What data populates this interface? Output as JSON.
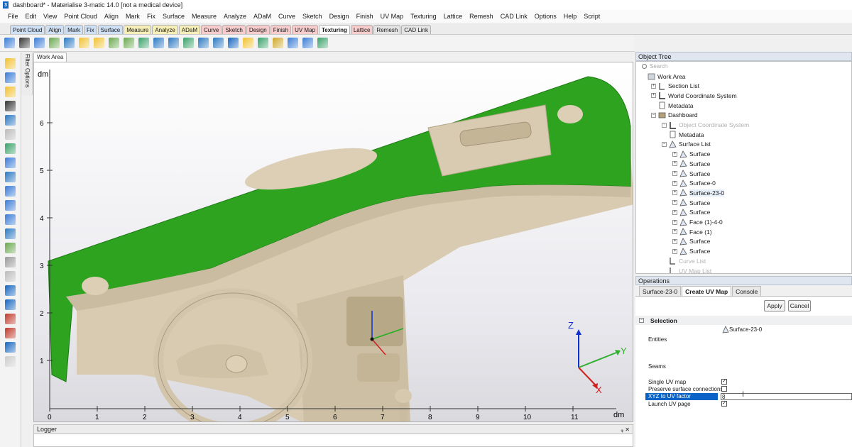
{
  "window": {
    "title": "dashboard* - Materialise 3-matic 14.0 [not a medical device]",
    "logo": "3"
  },
  "menu": [
    "File",
    "Edit",
    "View",
    "Point Cloud",
    "Align",
    "Mark",
    "Fix",
    "Surface",
    "Measure",
    "Analyze",
    "ADaM",
    "Curve",
    "Sketch",
    "Design",
    "Finish",
    "UV Map",
    "Texturing",
    "Lattice",
    "Remesh",
    "CAD Link",
    "Options",
    "Help",
    "Script"
  ],
  "ribbon_tabs": [
    {
      "label": "Point Cloud",
      "color": "#cfe0f5"
    },
    {
      "label": "Align",
      "color": "#cfe0f5"
    },
    {
      "label": "Mark",
      "color": "#cfe0f5"
    },
    {
      "label": "Fix",
      "color": "#cfe0f5"
    },
    {
      "label": "Surface",
      "color": "#cfe0f5"
    },
    {
      "label": "Measure",
      "color": "#f7efb8"
    },
    {
      "label": "Analyze",
      "color": "#f7efb8"
    },
    {
      "label": "ADaM",
      "color": "#f7efb8"
    },
    {
      "label": "Curve",
      "color": "#f6cccc"
    },
    {
      "label": "Sketch",
      "color": "#f6cccc"
    },
    {
      "label": "Design",
      "color": "#f6cccc"
    },
    {
      "label": "Finish",
      "color": "#f6cccc"
    },
    {
      "label": "UV Map",
      "color": "#f6cccc"
    },
    {
      "label": "Texturing",
      "color": "#f6cccc",
      "active": true
    },
    {
      "label": "Lattice",
      "color": "#f6cccc"
    },
    {
      "label": "Remesh",
      "color": "#e4e4e4"
    },
    {
      "label": "CAD Link",
      "color": "#e4e4e4"
    }
  ],
  "toolbar_icon_colors": [
    "#3a7bd5",
    "#333",
    "#3a7bd5",
    "#6aa84f",
    "#2b78c2",
    "#f1c232",
    "#f1c232",
    "#6aa84f",
    "#6aa84f",
    "#38a169",
    "#2b78c2",
    "#2b78c2",
    "#38a169",
    "#2b78c2",
    "#2b78c2",
    "#1565c0",
    "#f1c232",
    "#38a169",
    "#cfa82a",
    "#3a7bd5",
    "#3a7bd5",
    "#38a169"
  ],
  "left_icon_colors": [
    "#f1c232",
    "#3a7bd5",
    "#f1c232",
    "#333",
    "#2b78c2",
    "#bbb",
    "#38a169",
    "#3a7bd5",
    "#2b78c2",
    "#3a7bd5",
    "#3a7bd5",
    "#3a7bd5",
    "#2b78c2",
    "#6aa84f",
    "#999",
    "#bbb",
    "#1565c0",
    "#1565c0",
    "#c0392b",
    "#c0392b",
    "#1565c0",
    "#ccc"
  ],
  "filter_options": "Filter Options",
  "work_area_tab": "Work Area",
  "viewport": {
    "axis_unit": "dm",
    "x_ticks": [
      "0",
      "1",
      "2",
      "3",
      "4",
      "5",
      "6",
      "7",
      "8",
      "9",
      "10",
      "11"
    ],
    "y_ticks": [
      "1",
      "2",
      "3",
      "4",
      "5",
      "6"
    ],
    "triad": {
      "z": "Z",
      "y": "Y",
      "x": "X"
    }
  },
  "logger": {
    "title": "Logger",
    "pin": "ᵩ ✕"
  },
  "object_tree": {
    "title": "Object Tree",
    "search_placeholder": "Search",
    "nodes": [
      {
        "label": "Work Area",
        "depth": 0,
        "expander": "",
        "icon": "work"
      },
      {
        "label": "Section List",
        "depth": 1,
        "expander": "+",
        "icon": "list"
      },
      {
        "label": "World Coordinate System",
        "depth": 1,
        "expander": "+",
        "icon": "axis"
      },
      {
        "label": "Metadata",
        "depth": 1,
        "expander": "",
        "icon": "doc"
      },
      {
        "label": "Dashboard",
        "depth": 1,
        "expander": "−",
        "icon": "part"
      },
      {
        "label": "Object Coordinate System",
        "depth": 2,
        "expander": "+",
        "icon": "axis",
        "dim": true
      },
      {
        "label": "Metadata",
        "depth": 2,
        "expander": "",
        "icon": "doc"
      },
      {
        "label": "Surface List",
        "depth": 2,
        "expander": "−",
        "icon": "surf"
      },
      {
        "label": "Surface",
        "depth": 3,
        "expander": "+",
        "icon": "surf"
      },
      {
        "label": "Surface",
        "depth": 3,
        "expander": "+",
        "icon": "surf"
      },
      {
        "label": "Surface",
        "depth": 3,
        "expander": "+",
        "icon": "surf"
      },
      {
        "label": "Surface-0",
        "depth": 3,
        "expander": "+",
        "icon": "surf"
      },
      {
        "label": "Surface-23-0",
        "depth": 3,
        "expander": "+",
        "icon": "surf",
        "selected": true
      },
      {
        "label": "Surface",
        "depth": 3,
        "expander": "+",
        "icon": "surf"
      },
      {
        "label": "Surface",
        "depth": 3,
        "expander": "+",
        "icon": "surf"
      },
      {
        "label": "Face (1)-4-0",
        "depth": 3,
        "expander": "+",
        "icon": "surf"
      },
      {
        "label": "Face (1)",
        "depth": 3,
        "expander": "+",
        "icon": "surf"
      },
      {
        "label": "Surface",
        "depth": 3,
        "expander": "+",
        "icon": "surf"
      },
      {
        "label": "Surface",
        "depth": 3,
        "expander": "+",
        "icon": "surf"
      },
      {
        "label": "Curve List",
        "depth": 2,
        "expander": "",
        "icon": "list",
        "dim": true
      },
      {
        "label": "UV Map List",
        "depth": 2,
        "expander": "",
        "icon": "list",
        "dim": true
      }
    ]
  },
  "operations": {
    "title": "Operations",
    "tabs": [
      "Surface-23-0",
      "Create UV Map",
      "Console"
    ],
    "active_tab": 1,
    "apply_label": "Apply",
    "cancel_label": "Cancel",
    "section": "Selection",
    "entities_label": "Entities",
    "entities_value": "Surface-23-0",
    "seams_label": "Seams",
    "single_uv_label": "Single UV map",
    "single_uv_checked": true,
    "preserve_label": "Preserve surface connections",
    "preserve_checked": false,
    "factor_label": "XYZ to UV factor",
    "factor_value": "8",
    "launch_label": "Launch UV page",
    "launch_checked": true
  }
}
